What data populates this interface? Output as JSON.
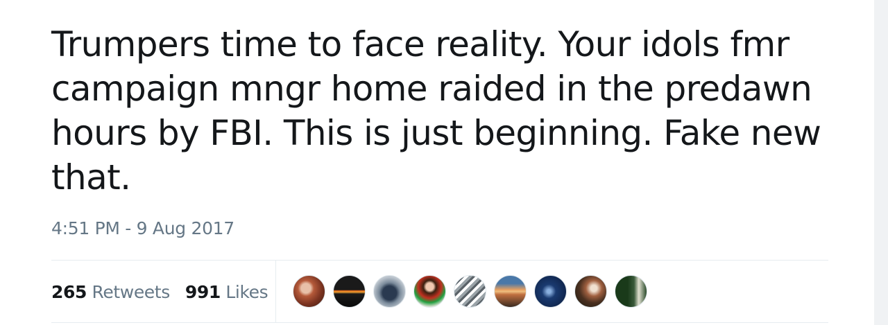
{
  "tweet": {
    "text": "Trumpers time to face reality. Your idols fmr campaign mngr home raided in the predawn hours by FBI. This is just beginning. Fake new that.",
    "timestamp": "4:51 PM - 9 Aug 2017"
  },
  "stats": {
    "retweets_count": "265",
    "retweets_label": "Retweets",
    "likes_count": "991",
    "likes_label": "Likes"
  },
  "likers": {
    "avatars": [
      {
        "icon": "avatar-woman-red-hair"
      },
      {
        "icon": "avatar-sunset-dark"
      },
      {
        "icon": "avatar-motorcycle-rider"
      },
      {
        "icon": "avatar-woman-colorful-dress"
      },
      {
        "icon": "avatar-statue-of-liberty"
      },
      {
        "icon": "avatar-beach-sunset"
      },
      {
        "icon": "avatar-lightning-storm"
      },
      {
        "icon": "avatar-mixed-collage"
      },
      {
        "icon": "avatar-green-text-man"
      }
    ]
  },
  "colors": {
    "text_primary": "#14171a",
    "text_secondary": "#657786",
    "divider": "#e6ecf0"
  }
}
